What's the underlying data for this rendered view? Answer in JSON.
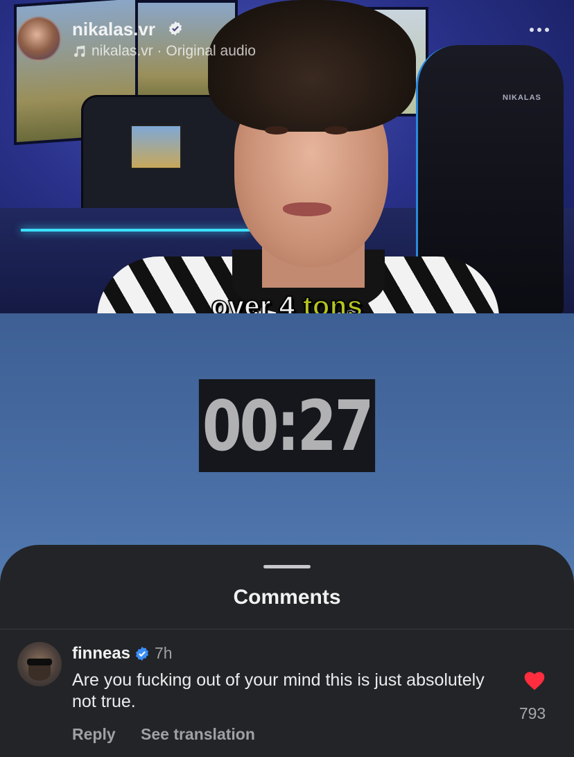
{
  "post": {
    "username": "nikalas.vr",
    "audio_label": "nikalas.vr · Original audio",
    "icons": {
      "verified": "verified-badge-icon",
      "audio": "music-note-icon",
      "more": "more-options-icon"
    }
  },
  "video": {
    "caption_word1": "over 4",
    "caption_word2": "tons",
    "caption_color1": "#f0f0f0",
    "caption_color2": "#b4c322",
    "timer": "00:27",
    "chair_logo": "NIKALAS"
  },
  "comments_sheet": {
    "title": "Comments"
  },
  "comment": {
    "username": "finneas",
    "time": "7h",
    "text": "Are you fucking out of your mind this is just absolutely not true.",
    "likes": "793",
    "reply_label": "Reply",
    "translate_label": "See translation",
    "heart_color": "#ff2d3d",
    "verified_color": "#3a8ef6"
  }
}
